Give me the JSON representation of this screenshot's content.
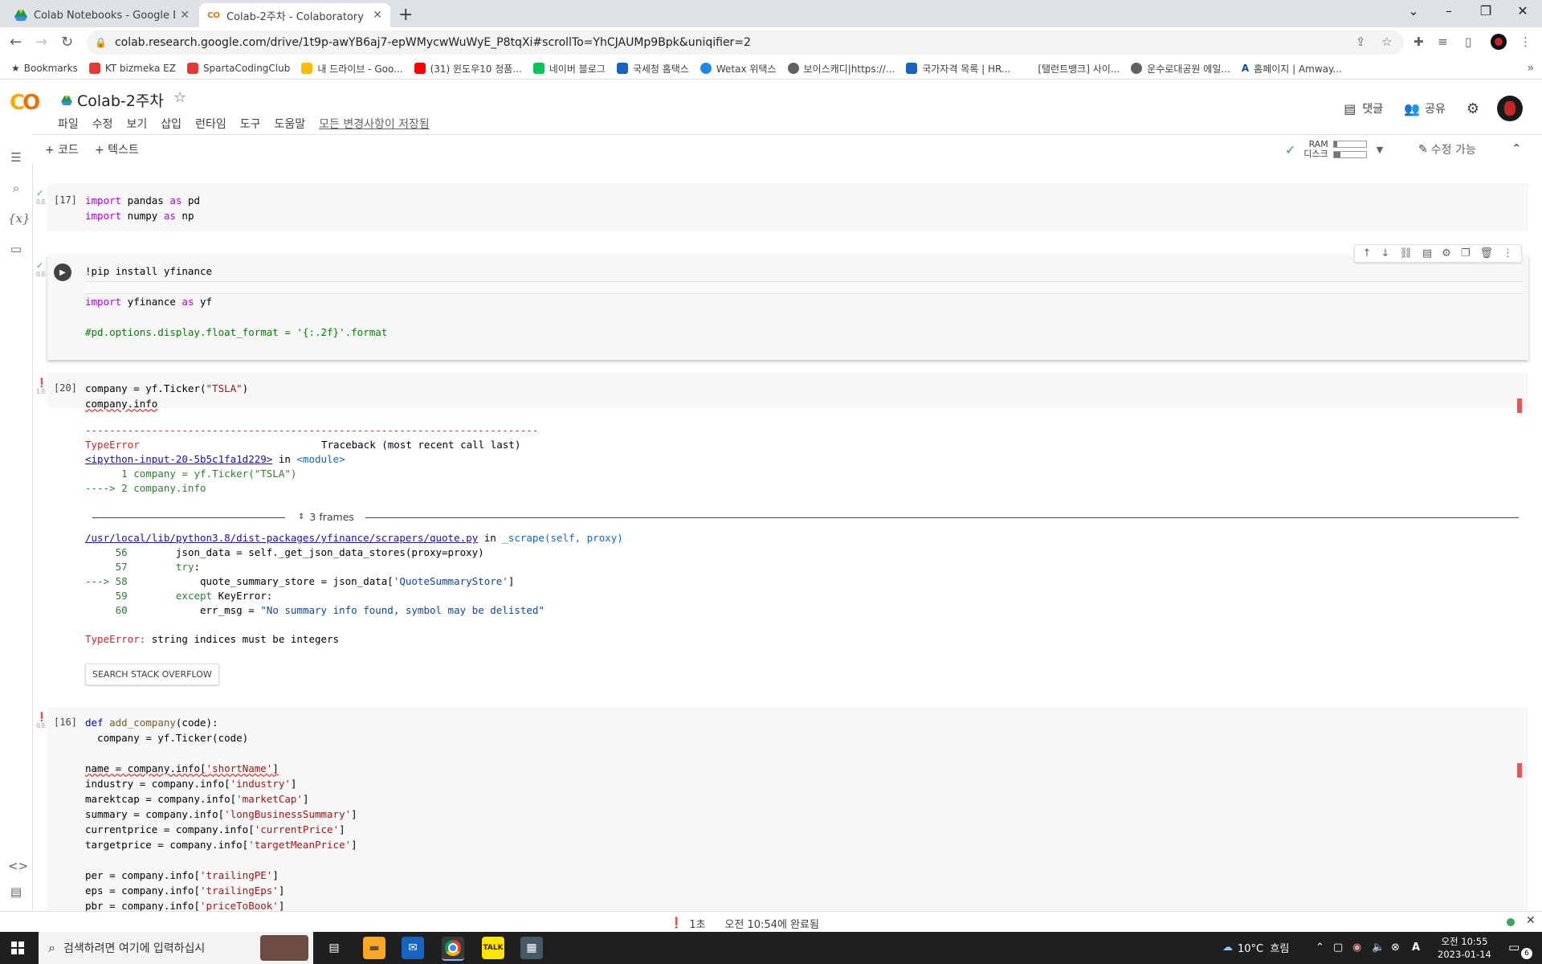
{
  "browser": {
    "tabs": [
      {
        "label": "Colab Notebooks - Google Drive",
        "icon": "google-drive-icon"
      },
      {
        "label": "Colab-2주차 - Colaboratory",
        "icon": "colab-icon"
      }
    ],
    "url": "colab.research.google.com/drive/1t9p-awYB6aj7-epWMycwWuWyE_P8tqXi#scrollTo=YhCJAUMp9Bpk&uniqifier=2",
    "bookmarks": [
      {
        "label": "Bookmarks",
        "color": "#5f6368"
      },
      {
        "label": "KT bizmeka EZ",
        "color": "#e53935"
      },
      {
        "label": "SpartaCodingClub",
        "color": "#e53935"
      },
      {
        "label": "내 드라이브 - Goo...",
        "color": "#fbbc04"
      },
      {
        "label": "(31) 윈도우10 정품...",
        "color": "#ff0000"
      },
      {
        "label": "네이버 블로그",
        "color": "#03c75a"
      },
      {
        "label": "국세청 홈택스",
        "color": "#1565c0"
      },
      {
        "label": "Wetax 위택스",
        "color": "#1e88e5"
      },
      {
        "label": "보이스캐디|https://...",
        "color": "#616161"
      },
      {
        "label": "국가자격 목록 | HR...",
        "color": "#1565c0"
      },
      {
        "label": "[탤런트뱅크] 사이...",
        "color": "#ffffff"
      },
      {
        "label": "운수로대공원 에일...",
        "color": "#616161"
      },
      {
        "label": "홈페이지 | Amway...",
        "color": "#0d47a1"
      }
    ]
  },
  "colab": {
    "title": "Colab-2주차",
    "menu": [
      "파일",
      "수정",
      "보기",
      "삽입",
      "런타임",
      "도구",
      "도움말"
    ],
    "saved_status": "모든 변경사항이 저장됨",
    "comment_label": "댓글",
    "share_label": "공유",
    "add_code": "+ 코드",
    "add_text": "+ 텍스트",
    "ram_label": "RAM",
    "disk_label": "디스크",
    "edit_mode": "수정 가능"
  },
  "cells": {
    "c1": {
      "num": "[17]",
      "exec_time": "0초"
    },
    "c2": {
      "exec_time": "0초"
    },
    "c3": {
      "num": "[20]",
      "exec_time": "1초"
    },
    "c4": {
      "num": "[16]",
      "exec_time": "0초"
    }
  },
  "output": {
    "dashes": "---------------------------------------------------------------------------",
    "error_type": "TypeError",
    "traceback_label": "Traceback (most recent call last)",
    "input_link": "<ipython-input-20-5b5c1fa1d229>",
    "in_module": " in ",
    "module": "<module>",
    "line1": "      1 company = yf.Ticker(\"TSLA\")",
    "line2": "----> 2 company.info",
    "frames_label": "3 frames",
    "quote_link": "/usr/local/lib/python3.8/dist-packages/yfinance/scrapers/quote.py",
    "scrape_fn": "_scrape(self, proxy)",
    "final_error_type": "TypeError:",
    "final_error_msg": " string indices must be integers",
    "search_so": "SEARCH STACK OVERFLOW"
  },
  "statusbar": {
    "time_taken": "1초",
    "completed": "오전 10:54에 완료됨"
  },
  "taskbar": {
    "search_placeholder": "검색하려면 여기에 입력하십시",
    "weather": "10°C  흐림",
    "ime": "A",
    "time": "오전 10:55",
    "date": "2023-01-14",
    "notif_count": "6"
  }
}
